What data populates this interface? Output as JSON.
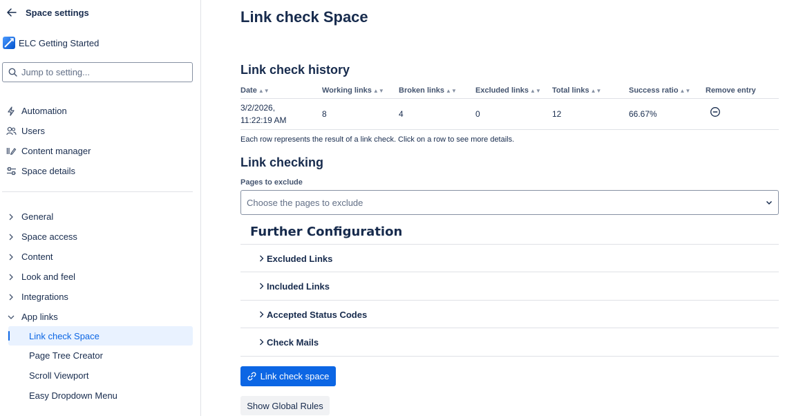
{
  "sidebar": {
    "title": "Space settings",
    "space_name": "ELC Getting Started",
    "search_placeholder": "Jump to setting...",
    "top_items": [
      {
        "label": "Automation",
        "icon": "lightning-icon"
      },
      {
        "label": "Users",
        "icon": "users-icon"
      },
      {
        "label": "Content manager",
        "icon": "content-manager-icon"
      },
      {
        "label": "Space details",
        "icon": "space-details-icon"
      }
    ],
    "groups": [
      {
        "label": "General",
        "expanded": false
      },
      {
        "label": "Space access",
        "expanded": false
      },
      {
        "label": "Content",
        "expanded": false
      },
      {
        "label": "Look and feel",
        "expanded": false
      },
      {
        "label": "Integrations",
        "expanded": false
      },
      {
        "label": "App links",
        "expanded": true
      }
    ],
    "app_links": [
      {
        "label": "Link check Space",
        "active": true
      },
      {
        "label": "Page Tree Creator",
        "active": false
      },
      {
        "label": "Scroll Viewport",
        "active": false
      },
      {
        "label": "Easy Dropdown Menu",
        "active": false
      }
    ]
  },
  "main": {
    "title": "Link check Space",
    "history_title": "Link check history",
    "table": {
      "headers": [
        "Date",
        "Working links",
        "Broken links",
        "Excluded links",
        "Total links",
        "Success ratio",
        "Remove entry"
      ],
      "rows": [
        {
          "date_line1": "3/2/2026,",
          "date_line2": "11:22:19 AM",
          "working": "8",
          "broken": "4",
          "excluded": "0",
          "total": "12",
          "ratio": "66.67%"
        }
      ]
    },
    "hint": "Each row represents the result of a link check. Click on a row to see more details.",
    "link_checking_title": "Link checking",
    "pages_to_exclude_label": "Pages to exclude",
    "pages_to_exclude_placeholder": "Choose the pages to exclude",
    "further_config_title": "Further Configuration",
    "accordions": [
      "Excluded Links",
      "Included Links",
      "Accepted Status Codes",
      "Check Mails"
    ],
    "primary_button": "Link check space",
    "secondary_button": "Show Global Rules"
  },
  "colors": {
    "primary": "#0c66e4",
    "text": "#172b4d",
    "subtle": "#44546f",
    "active_bg": "#e9f2ff"
  }
}
